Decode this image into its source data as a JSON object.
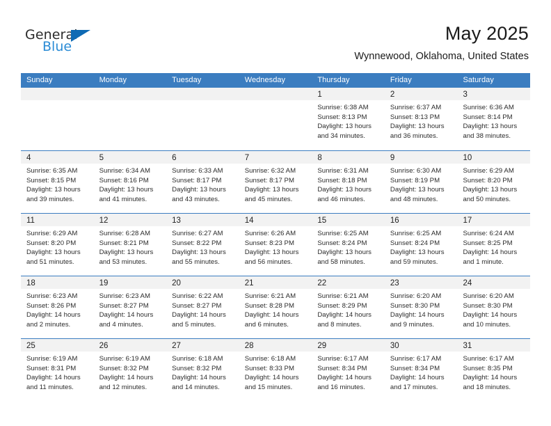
{
  "brand": {
    "name_part1": "General",
    "name_part2": "Blue",
    "triangle_color": "#0f6ab4",
    "blue_color": "#2a8bd5"
  },
  "header": {
    "title": "May 2025",
    "subtitle": "Wynnewood, Oklahoma, United States",
    "header_bg": "#3b7dc0",
    "day_band_bg": "#f2f2f2"
  },
  "calendar": {
    "weekday_names": [
      "Sunday",
      "Monday",
      "Tuesday",
      "Wednesday",
      "Thursday",
      "Friday",
      "Saturday"
    ],
    "weeks": [
      [
        {
          "day": "",
          "lines": []
        },
        {
          "day": "",
          "lines": []
        },
        {
          "day": "",
          "lines": []
        },
        {
          "day": "",
          "lines": []
        },
        {
          "day": "1",
          "lines": [
            "Sunrise: 6:38 AM",
            "Sunset: 8:13 PM",
            "Daylight: 13 hours",
            "and 34 minutes."
          ]
        },
        {
          "day": "2",
          "lines": [
            "Sunrise: 6:37 AM",
            "Sunset: 8:13 PM",
            "Daylight: 13 hours",
            "and 36 minutes."
          ]
        },
        {
          "day": "3",
          "lines": [
            "Sunrise: 6:36 AM",
            "Sunset: 8:14 PM",
            "Daylight: 13 hours",
            "and 38 minutes."
          ]
        }
      ],
      [
        {
          "day": "4",
          "lines": [
            "Sunrise: 6:35 AM",
            "Sunset: 8:15 PM",
            "Daylight: 13 hours",
            "and 39 minutes."
          ]
        },
        {
          "day": "5",
          "lines": [
            "Sunrise: 6:34 AM",
            "Sunset: 8:16 PM",
            "Daylight: 13 hours",
            "and 41 minutes."
          ]
        },
        {
          "day": "6",
          "lines": [
            "Sunrise: 6:33 AM",
            "Sunset: 8:17 PM",
            "Daylight: 13 hours",
            "and 43 minutes."
          ]
        },
        {
          "day": "7",
          "lines": [
            "Sunrise: 6:32 AM",
            "Sunset: 8:17 PM",
            "Daylight: 13 hours",
            "and 45 minutes."
          ]
        },
        {
          "day": "8",
          "lines": [
            "Sunrise: 6:31 AM",
            "Sunset: 8:18 PM",
            "Daylight: 13 hours",
            "and 46 minutes."
          ]
        },
        {
          "day": "9",
          "lines": [
            "Sunrise: 6:30 AM",
            "Sunset: 8:19 PM",
            "Daylight: 13 hours",
            "and 48 minutes."
          ]
        },
        {
          "day": "10",
          "lines": [
            "Sunrise: 6:29 AM",
            "Sunset: 8:20 PM",
            "Daylight: 13 hours",
            "and 50 minutes."
          ]
        }
      ],
      [
        {
          "day": "11",
          "lines": [
            "Sunrise: 6:29 AM",
            "Sunset: 8:20 PM",
            "Daylight: 13 hours",
            "and 51 minutes."
          ]
        },
        {
          "day": "12",
          "lines": [
            "Sunrise: 6:28 AM",
            "Sunset: 8:21 PM",
            "Daylight: 13 hours",
            "and 53 minutes."
          ]
        },
        {
          "day": "13",
          "lines": [
            "Sunrise: 6:27 AM",
            "Sunset: 8:22 PM",
            "Daylight: 13 hours",
            "and 55 minutes."
          ]
        },
        {
          "day": "14",
          "lines": [
            "Sunrise: 6:26 AM",
            "Sunset: 8:23 PM",
            "Daylight: 13 hours",
            "and 56 minutes."
          ]
        },
        {
          "day": "15",
          "lines": [
            "Sunrise: 6:25 AM",
            "Sunset: 8:24 PM",
            "Daylight: 13 hours",
            "and 58 minutes."
          ]
        },
        {
          "day": "16",
          "lines": [
            "Sunrise: 6:25 AM",
            "Sunset: 8:24 PM",
            "Daylight: 13 hours",
            "and 59 minutes."
          ]
        },
        {
          "day": "17",
          "lines": [
            "Sunrise: 6:24 AM",
            "Sunset: 8:25 PM",
            "Daylight: 14 hours",
            "and 1 minute."
          ]
        }
      ],
      [
        {
          "day": "18",
          "lines": [
            "Sunrise: 6:23 AM",
            "Sunset: 8:26 PM",
            "Daylight: 14 hours",
            "and 2 minutes."
          ]
        },
        {
          "day": "19",
          "lines": [
            "Sunrise: 6:23 AM",
            "Sunset: 8:27 PM",
            "Daylight: 14 hours",
            "and 4 minutes."
          ]
        },
        {
          "day": "20",
          "lines": [
            "Sunrise: 6:22 AM",
            "Sunset: 8:27 PM",
            "Daylight: 14 hours",
            "and 5 minutes."
          ]
        },
        {
          "day": "21",
          "lines": [
            "Sunrise: 6:21 AM",
            "Sunset: 8:28 PM",
            "Daylight: 14 hours",
            "and 6 minutes."
          ]
        },
        {
          "day": "22",
          "lines": [
            "Sunrise: 6:21 AM",
            "Sunset: 8:29 PM",
            "Daylight: 14 hours",
            "and 8 minutes."
          ]
        },
        {
          "day": "23",
          "lines": [
            "Sunrise: 6:20 AM",
            "Sunset: 8:30 PM",
            "Daylight: 14 hours",
            "and 9 minutes."
          ]
        },
        {
          "day": "24",
          "lines": [
            "Sunrise: 6:20 AM",
            "Sunset: 8:30 PM",
            "Daylight: 14 hours",
            "and 10 minutes."
          ]
        }
      ],
      [
        {
          "day": "25",
          "lines": [
            "Sunrise: 6:19 AM",
            "Sunset: 8:31 PM",
            "Daylight: 14 hours",
            "and 11 minutes."
          ]
        },
        {
          "day": "26",
          "lines": [
            "Sunrise: 6:19 AM",
            "Sunset: 8:32 PM",
            "Daylight: 14 hours",
            "and 12 minutes."
          ]
        },
        {
          "day": "27",
          "lines": [
            "Sunrise: 6:18 AM",
            "Sunset: 8:32 PM",
            "Daylight: 14 hours",
            "and 14 minutes."
          ]
        },
        {
          "day": "28",
          "lines": [
            "Sunrise: 6:18 AM",
            "Sunset: 8:33 PM",
            "Daylight: 14 hours",
            "and 15 minutes."
          ]
        },
        {
          "day": "29",
          "lines": [
            "Sunrise: 6:17 AM",
            "Sunset: 8:34 PM",
            "Daylight: 14 hours",
            "and 16 minutes."
          ]
        },
        {
          "day": "30",
          "lines": [
            "Sunrise: 6:17 AM",
            "Sunset: 8:34 PM",
            "Daylight: 14 hours",
            "and 17 minutes."
          ]
        },
        {
          "day": "31",
          "lines": [
            "Sunrise: 6:17 AM",
            "Sunset: 8:35 PM",
            "Daylight: 14 hours",
            "and 18 minutes."
          ]
        }
      ]
    ]
  }
}
